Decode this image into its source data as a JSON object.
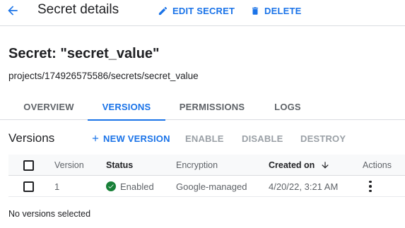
{
  "header": {
    "title": "Secret details",
    "edit_label": "EDIT SECRET",
    "delete_label": "DELETE"
  },
  "secret": {
    "title": "Secret: \"secret_value\"",
    "path": "projects/174926575586/secrets/secret_value"
  },
  "tabs": [
    {
      "label": "OVERVIEW",
      "active": false
    },
    {
      "label": "VERSIONS",
      "active": true
    },
    {
      "label": "PERMISSIONS",
      "active": false
    },
    {
      "label": "LOGS",
      "active": false
    }
  ],
  "versions": {
    "heading": "Versions",
    "new_version_label": "NEW VERSION",
    "enable_label": "ENABLE",
    "disable_label": "DISABLE",
    "destroy_label": "DESTROY"
  },
  "table": {
    "columns": {
      "version": "Version",
      "status": "Status",
      "encryption": "Encryption",
      "created_on": "Created on",
      "actions": "Actions"
    },
    "rows": [
      {
        "version": "1",
        "status": "Enabled",
        "encryption": "Google-managed",
        "created_on": "4/20/22, 3:21 AM"
      }
    ]
  },
  "footer_note": "No versions selected",
  "colors": {
    "accent": "#1a73e8",
    "disabled": "#9aa0a6",
    "success": "#188038"
  }
}
